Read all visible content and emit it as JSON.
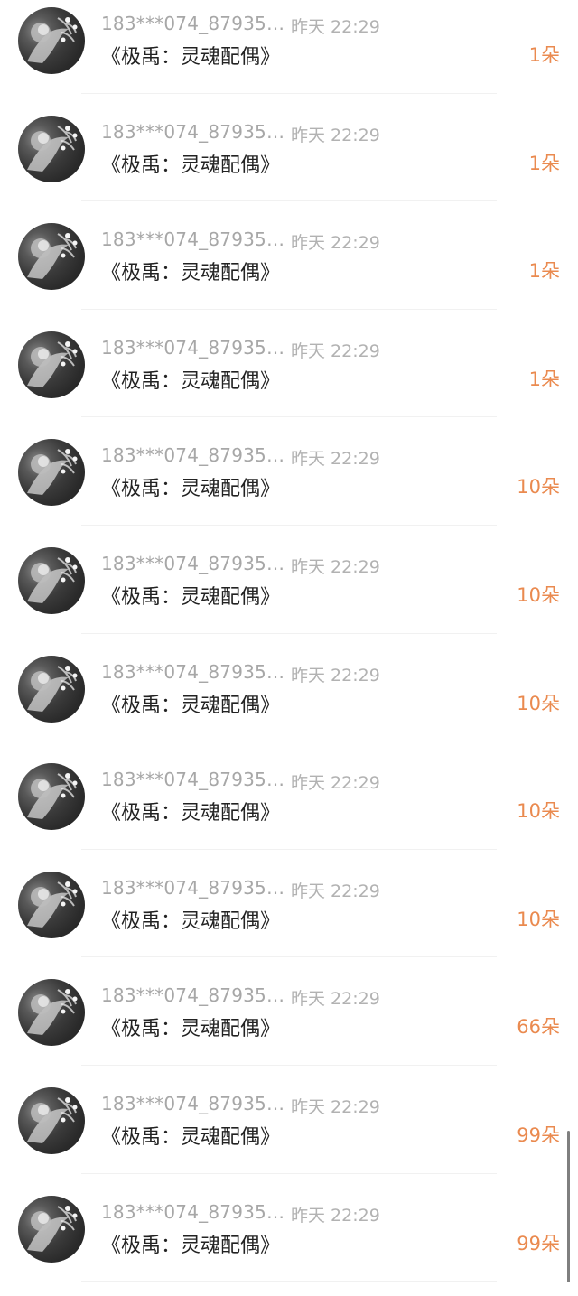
{
  "rows": [
    {
      "username": "183***074_87935…",
      "time": "昨天 22:29",
      "book": "《极禹：灵魂配偶》",
      "amount": "1朵"
    },
    {
      "username": "183***074_87935…",
      "time": "昨天 22:29",
      "book": "《极禹：灵魂配偶》",
      "amount": "1朵"
    },
    {
      "username": "183***074_87935…",
      "time": "昨天 22:29",
      "book": "《极禹：灵魂配偶》",
      "amount": "1朵"
    },
    {
      "username": "183***074_87935…",
      "time": "昨天 22:29",
      "book": "《极禹：灵魂配偶》",
      "amount": "1朵"
    },
    {
      "username": "183***074_87935…",
      "time": "昨天 22:29",
      "book": "《极禹：灵魂配偶》",
      "amount": "10朵"
    },
    {
      "username": "183***074_87935…",
      "time": "昨天 22:29",
      "book": "《极禹：灵魂配偶》",
      "amount": "10朵"
    },
    {
      "username": "183***074_87935…",
      "time": "昨天 22:29",
      "book": "《极禹：灵魂配偶》",
      "amount": "10朵"
    },
    {
      "username": "183***074_87935…",
      "time": "昨天 22:29",
      "book": "《极禹：灵魂配偶》",
      "amount": "10朵"
    },
    {
      "username": "183***074_87935…",
      "time": "昨天 22:29",
      "book": "《极禹：灵魂配偶》",
      "amount": "10朵"
    },
    {
      "username": "183***074_87935…",
      "time": "昨天 22:29",
      "book": "《极禹：灵魂配偶》",
      "amount": "66朵"
    },
    {
      "username": "183***074_87935…",
      "time": "昨天 22:29",
      "book": "《极禹：灵魂配偶》",
      "amount": "99朵"
    },
    {
      "username": "183***074_87935…",
      "time": "昨天 22:29",
      "book": "《极禹：灵魂配偶》",
      "amount": "99朵"
    }
  ],
  "colors": {
    "background": "#ffffff",
    "username": "#a7a7a7",
    "time": "#b2b2b2",
    "book_title": "#222222",
    "amount": "#ea8a4f",
    "divider": "#f1f1f1"
  },
  "icons": {
    "avatar": "user-avatar-image"
  }
}
